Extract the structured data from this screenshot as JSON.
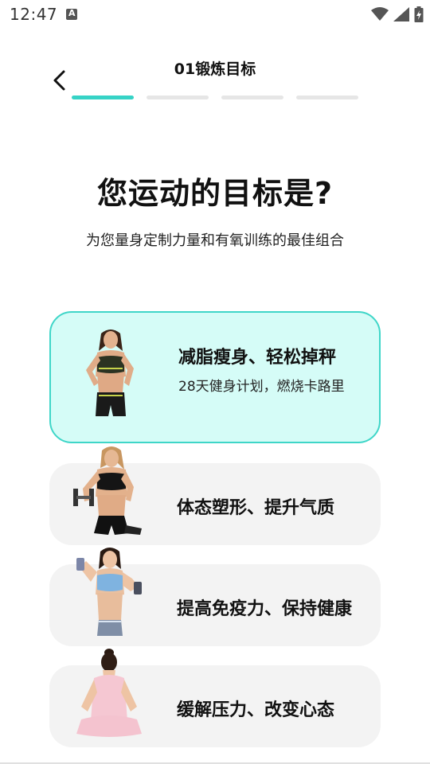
{
  "status_bar": {
    "time": "12:47",
    "icons": [
      "wifi-icon",
      "signal-icon",
      "battery-charging-icon"
    ]
  },
  "header": {
    "title": "01锻炼目标",
    "progress_steps": 4,
    "progress_active": 1
  },
  "main": {
    "heading": "您运动的目标是?",
    "subheading": "为您量身定制力量和有氧训练的最佳组合"
  },
  "goals": [
    {
      "title": "减脂瘦身、轻松掉秤",
      "description": "28天健身计划，燃烧卡路里",
      "selected": true
    },
    {
      "title": "体态塑形、提升气质",
      "description": "",
      "selected": false
    },
    {
      "title": "提高免疫力、保持健康",
      "description": "",
      "selected": false
    },
    {
      "title": "缓解压力、改变心态",
      "description": "",
      "selected": false
    }
  ],
  "colors": {
    "accent": "#36d3c6",
    "selected_card_bg": "#d5fcf7",
    "card_bg": "#f3f3f3"
  }
}
